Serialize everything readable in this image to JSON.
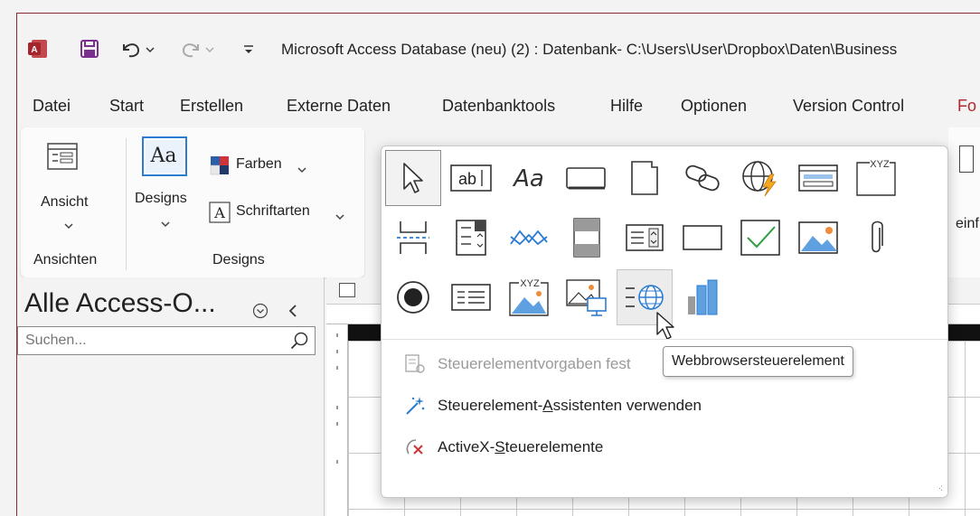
{
  "title_bar": {
    "title": "Microsoft Access Database (neu) (2) : Datenbank- C:\\Users\\User\\Dropbox\\Daten\\Business"
  },
  "menu": {
    "tabs": [
      "Datei",
      "Start",
      "Erstellen",
      "Externe Daten",
      "Datenbanktools",
      "Hilfe",
      "Optionen",
      "Version Control",
      "Fo"
    ]
  },
  "ribbon": {
    "ansicht": "Ansicht",
    "designs": "Designs",
    "farben": "Farben",
    "schriftarten": "Schriftarten",
    "group_ansichten": "Ansichten",
    "group_designs": "Designs",
    "right_cut": "einf"
  },
  "nav": {
    "title": "Alle Access-O...",
    "search_placeholder": "Suchen..."
  },
  "gallery": {
    "menu_item_1": "Steuerelementvorgaben festlegen",
    "menu_item_1_visible": "Steuerelementvorgaben fest",
    "menu_item_2_pre": "Steuerelement-",
    "menu_item_2_key": "A",
    "menu_item_2_post": "ssistenten verwenden",
    "menu_item_3_pre": "ActiveX-",
    "menu_item_3_key": "S",
    "menu_item_3_post": "teuerelemente",
    "tooltip": "Webbrowsersteuerelement"
  },
  "colors": {
    "accent": "#b3262b",
    "access_red": "#a4262c",
    "save_purple": "#7a2e8e",
    "blue": "#2b7cd3"
  }
}
